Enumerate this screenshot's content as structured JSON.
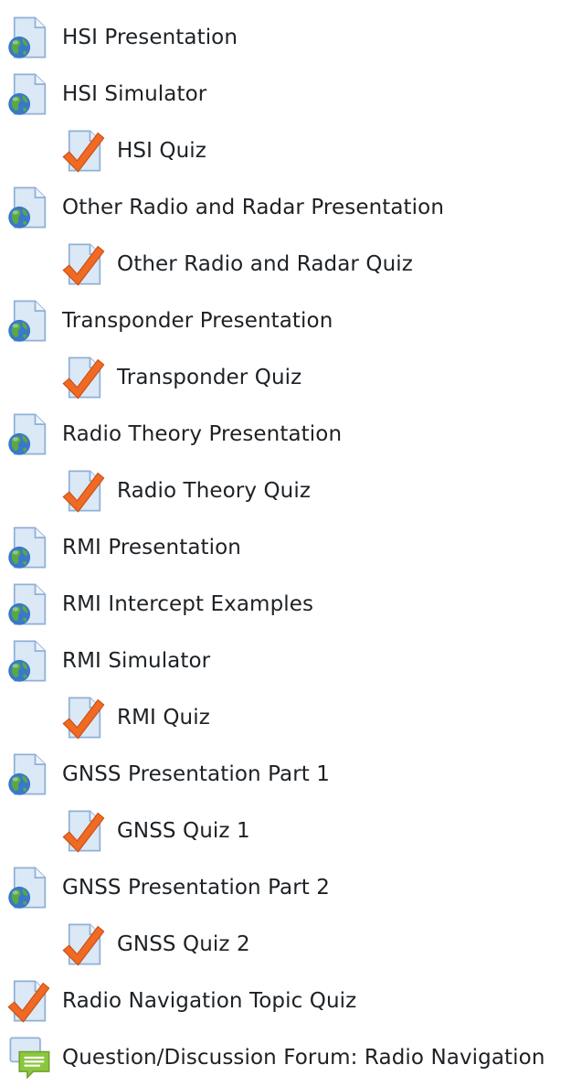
{
  "activities": [
    {
      "label": "HSI Presentation",
      "icon": "url-globe-icon",
      "indent": false
    },
    {
      "label": "HSI Simulator",
      "icon": "url-globe-icon",
      "indent": false
    },
    {
      "label": "HSI Quiz",
      "icon": "quiz-checkmark-icon",
      "indent": true
    },
    {
      "label": "Other Radio and Radar Presentation",
      "icon": "url-globe-icon",
      "indent": false
    },
    {
      "label": "Other Radio and Radar Quiz",
      "icon": "quiz-checkmark-icon",
      "indent": true
    },
    {
      "label": "Transponder Presentation",
      "icon": "url-globe-icon",
      "indent": false
    },
    {
      "label": "Transponder Quiz",
      "icon": "quiz-checkmark-icon",
      "indent": true
    },
    {
      "label": "Radio Theory Presentation",
      "icon": "url-globe-icon",
      "indent": false
    },
    {
      "label": "Radio Theory Quiz",
      "icon": "quiz-checkmark-icon",
      "indent": true
    },
    {
      "label": "RMI Presentation",
      "icon": "url-globe-icon",
      "indent": false
    },
    {
      "label": "RMI Intercept Examples",
      "icon": "url-globe-icon",
      "indent": false
    },
    {
      "label": "RMI Simulator",
      "icon": "url-globe-icon",
      "indent": false
    },
    {
      "label": "RMI Quiz",
      "icon": "quiz-checkmark-icon",
      "indent": true
    },
    {
      "label": "GNSS Presentation Part 1",
      "icon": "url-globe-icon",
      "indent": false
    },
    {
      "label": "GNSS Quiz 1",
      "icon": "quiz-checkmark-icon",
      "indent": true
    },
    {
      "label": "GNSS Presentation Part 2",
      "icon": "url-globe-icon",
      "indent": false
    },
    {
      "label": "GNSS Quiz 2",
      "icon": "quiz-checkmark-icon",
      "indent": true
    },
    {
      "label": "Radio Navigation Topic Quiz",
      "icon": "quiz-checkmark-icon",
      "indent": false
    },
    {
      "label": "Question/Discussion Forum: Radio Navigation",
      "icon": "forum-chat-icon",
      "indent": false
    }
  ],
  "colors": {
    "doc_fill": "#dbe8f6",
    "doc_stroke": "#8fb0d6",
    "globe_blue": "#3a78c9",
    "globe_green": "#5aa843",
    "check_orange": "#f06a24",
    "forum_green": "#8cc63f"
  }
}
